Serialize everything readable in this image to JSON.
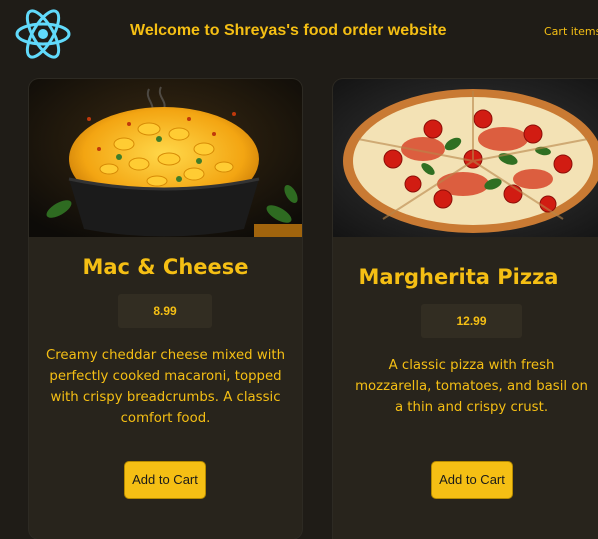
{
  "header": {
    "logo_icon": "react-logo-icon",
    "title": "Welcome to Shreyas's food order website",
    "cart_label": "Cart items"
  },
  "menu": {
    "items": [
      {
        "name": "Mac & Cheese",
        "price": "8.99",
        "description": "Creamy cheddar cheese mixed with perfectly cooked macaroni, topped with crispy breadcrumbs. A classic comfort food.",
        "button_label": "Add to Cart",
        "image_icon": "mac-and-cheese-photo"
      },
      {
        "name": "Margherita Pizza",
        "price": "12.99",
        "description": "A classic pizza with fresh mozzarella, tomatoes, and basil on a thin and crispy crust.",
        "button_label": "Add to Cart",
        "image_icon": "margherita-pizza-photo"
      }
    ]
  },
  "colors": {
    "background": "#1f1c17",
    "card": "#28241c",
    "accent": "#f5bf14",
    "react_blue": "#61dafb"
  }
}
